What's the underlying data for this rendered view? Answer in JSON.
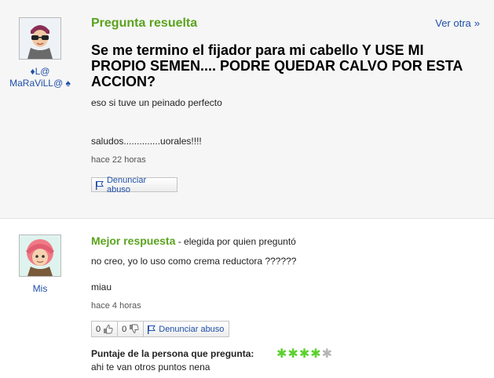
{
  "question": {
    "header_label": "Pregunta resuelta",
    "see_more": "Ver otra",
    "asker_name": "♦L@ MaRaViLL@ ♠",
    "title": "Se me termino el fijador para mi cabello Y USE MI PROPIO SEMEN.... PODRE QUEDAR CALVO POR ESTA ACCION?",
    "body_line1": "eso si tuve un peinado perfecto",
    "body_line2": "saludos..............uorales!!!!",
    "time": "hace 22 horas",
    "report_label": "Denunciar abuso"
  },
  "answer": {
    "best_label": "Mejor respuesta",
    "chosen_by": " - elegida por quien preguntó",
    "answerer_name": "Mis",
    "body_line1": "no creo, yo lo uso como crema reductora ??????",
    "body_line2": "miau",
    "time": "hace 4 horas",
    "thumbs_up_count": "0",
    "thumbs_down_count": "0",
    "report_label": "Denunciar abuso",
    "rating_label": "Puntaje de la persona que pregunta:",
    "rating_stars": 4,
    "rating_max": 5,
    "rating_comment": "ahi te van otros puntos nena"
  },
  "colors": {
    "accent_green": "#5aa31d",
    "link_blue": "#1f4fa8",
    "star_on": "#5bd12f",
    "star_off": "#b5b5b5"
  },
  "icons": [
    "avatar-asker",
    "avatar-answerer",
    "flag-icon",
    "thumbs-up-icon",
    "thumbs-down-icon",
    "chevron-right-icon",
    "star-icon"
  ]
}
